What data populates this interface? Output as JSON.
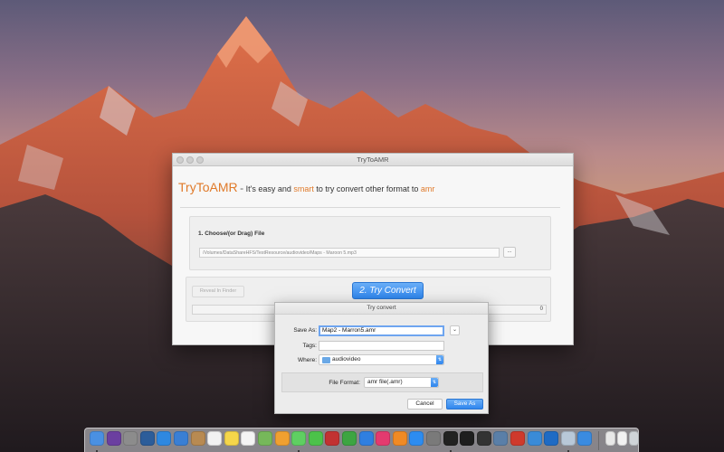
{
  "window": {
    "title": "TryToAMR"
  },
  "header": {
    "app_name": "TryToAMR",
    "dash": "-",
    "text1": " It's easy and ",
    "word_smart": "smart",
    "text2": " to try convert other format to ",
    "word_amr": "amr"
  },
  "step1": {
    "label": "1. Choose/(or Drag) File",
    "path": "/Volumes/DataShareHFS/TestResource/audiovideo/Maps - Maroon 5.mp3",
    "browse_label": "..."
  },
  "step2": {
    "reveal_label": "Reveal In Finder",
    "convert_label": "2. Try Convert",
    "progress_value": "0"
  },
  "save_sheet": {
    "title": "Try convert",
    "save_as_label": "Save As:",
    "save_as_value": "Map2 - Marron5.amr",
    "expand_label": "⌄",
    "tags_label": "Tags:",
    "tags_value": "",
    "where_label": "Where:",
    "where_value": "audiovideo",
    "file_format_label": "File Format:",
    "file_format_value": "amr file(.amr)",
    "cancel_label": "Cancel",
    "save_label": "Save As"
  },
  "dock": {
    "icons": [
      {
        "name": "finder-icon",
        "color": "#4a90e2"
      },
      {
        "name": "siri-icon",
        "color": "#6b3fa0"
      },
      {
        "name": "launchpad-icon",
        "color": "#8c8c8c"
      },
      {
        "name": "mission-control-icon",
        "color": "#2c5d9a"
      },
      {
        "name": "safari-icon",
        "color": "#2e88e0"
      },
      {
        "name": "mail-icon",
        "color": "#3a7fd4"
      },
      {
        "name": "contacts-icon",
        "color": "#b88a52"
      },
      {
        "name": "calendar-icon",
        "color": "#f2f2f2"
      },
      {
        "name": "notes-icon",
        "color": "#f5d64a"
      },
      {
        "name": "reminders-icon",
        "color": "#f4f4f4"
      },
      {
        "name": "maps-icon",
        "color": "#76b85a"
      },
      {
        "name": "photos-icon",
        "color": "#f0a030"
      },
      {
        "name": "messages-icon",
        "color": "#5fcf62"
      },
      {
        "name": "facetime-icon",
        "color": "#4cc24a"
      },
      {
        "name": "photo-booth-icon",
        "color": "#c23232"
      },
      {
        "name": "numbers-icon",
        "color": "#3da542"
      },
      {
        "name": "keynote-icon",
        "color": "#2f7fe0"
      },
      {
        "name": "itunes-icon",
        "color": "#e43a6f"
      },
      {
        "name": "ibooks-icon",
        "color": "#f08a24"
      },
      {
        "name": "app-store-icon",
        "color": "#2d8cf0"
      },
      {
        "name": "system-preferences-icon",
        "color": "#7a7a7a"
      },
      {
        "name": "terminal-icon",
        "color": "#222222"
      },
      {
        "name": "activity-monitor-icon",
        "color": "#1e1e1e"
      },
      {
        "name": "console-icon",
        "color": "#333333"
      },
      {
        "name": "network-utility-icon",
        "color": "#5a7fa8"
      },
      {
        "name": "compass-icon",
        "color": "#cf3a2c"
      },
      {
        "name": "xcode-icon",
        "color": "#3a8bd8"
      },
      {
        "name": "visual-studio-code-icon",
        "color": "#1f6bc4"
      },
      {
        "name": "preview-icon",
        "color": "#b8c8d8"
      },
      {
        "name": "tryto-icon",
        "color": "#3a8be0"
      },
      {
        "name": "textedit-icon",
        "color": "#e8e8e8"
      },
      {
        "name": "document-icon",
        "color": "#f2f2f2"
      },
      {
        "name": "trash-icon",
        "color": "#cfd4d8"
      }
    ]
  }
}
